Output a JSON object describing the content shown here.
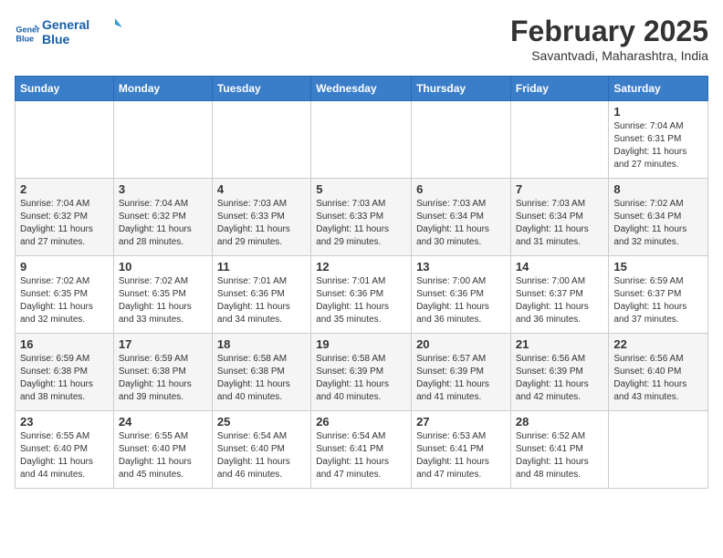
{
  "logo": {
    "general": "General",
    "blue": "Blue"
  },
  "header": {
    "month": "February 2025",
    "location": "Savantvadi, Maharashtra, India"
  },
  "weekdays": [
    "Sunday",
    "Monday",
    "Tuesday",
    "Wednesday",
    "Thursday",
    "Friday",
    "Saturday"
  ],
  "weeks": [
    [
      {
        "day": "",
        "info": ""
      },
      {
        "day": "",
        "info": ""
      },
      {
        "day": "",
        "info": ""
      },
      {
        "day": "",
        "info": ""
      },
      {
        "day": "",
        "info": ""
      },
      {
        "day": "",
        "info": ""
      },
      {
        "day": "1",
        "info": "Sunrise: 7:04 AM\nSunset: 6:31 PM\nDaylight: 11 hours and 27 minutes."
      }
    ],
    [
      {
        "day": "2",
        "info": "Sunrise: 7:04 AM\nSunset: 6:32 PM\nDaylight: 11 hours and 27 minutes."
      },
      {
        "day": "3",
        "info": "Sunrise: 7:04 AM\nSunset: 6:32 PM\nDaylight: 11 hours and 28 minutes."
      },
      {
        "day": "4",
        "info": "Sunrise: 7:03 AM\nSunset: 6:33 PM\nDaylight: 11 hours and 29 minutes."
      },
      {
        "day": "5",
        "info": "Sunrise: 7:03 AM\nSunset: 6:33 PM\nDaylight: 11 hours and 29 minutes."
      },
      {
        "day": "6",
        "info": "Sunrise: 7:03 AM\nSunset: 6:34 PM\nDaylight: 11 hours and 30 minutes."
      },
      {
        "day": "7",
        "info": "Sunrise: 7:03 AM\nSunset: 6:34 PM\nDaylight: 11 hours and 31 minutes."
      },
      {
        "day": "8",
        "info": "Sunrise: 7:02 AM\nSunset: 6:34 PM\nDaylight: 11 hours and 32 minutes."
      }
    ],
    [
      {
        "day": "9",
        "info": "Sunrise: 7:02 AM\nSunset: 6:35 PM\nDaylight: 11 hours and 32 minutes."
      },
      {
        "day": "10",
        "info": "Sunrise: 7:02 AM\nSunset: 6:35 PM\nDaylight: 11 hours and 33 minutes."
      },
      {
        "day": "11",
        "info": "Sunrise: 7:01 AM\nSunset: 6:36 PM\nDaylight: 11 hours and 34 minutes."
      },
      {
        "day": "12",
        "info": "Sunrise: 7:01 AM\nSunset: 6:36 PM\nDaylight: 11 hours and 35 minutes."
      },
      {
        "day": "13",
        "info": "Sunrise: 7:00 AM\nSunset: 6:36 PM\nDaylight: 11 hours and 36 minutes."
      },
      {
        "day": "14",
        "info": "Sunrise: 7:00 AM\nSunset: 6:37 PM\nDaylight: 11 hours and 36 minutes."
      },
      {
        "day": "15",
        "info": "Sunrise: 6:59 AM\nSunset: 6:37 PM\nDaylight: 11 hours and 37 minutes."
      }
    ],
    [
      {
        "day": "16",
        "info": "Sunrise: 6:59 AM\nSunset: 6:38 PM\nDaylight: 11 hours and 38 minutes."
      },
      {
        "day": "17",
        "info": "Sunrise: 6:59 AM\nSunset: 6:38 PM\nDaylight: 11 hours and 39 minutes."
      },
      {
        "day": "18",
        "info": "Sunrise: 6:58 AM\nSunset: 6:38 PM\nDaylight: 11 hours and 40 minutes."
      },
      {
        "day": "19",
        "info": "Sunrise: 6:58 AM\nSunset: 6:39 PM\nDaylight: 11 hours and 40 minutes."
      },
      {
        "day": "20",
        "info": "Sunrise: 6:57 AM\nSunset: 6:39 PM\nDaylight: 11 hours and 41 minutes."
      },
      {
        "day": "21",
        "info": "Sunrise: 6:56 AM\nSunset: 6:39 PM\nDaylight: 11 hours and 42 minutes."
      },
      {
        "day": "22",
        "info": "Sunrise: 6:56 AM\nSunset: 6:40 PM\nDaylight: 11 hours and 43 minutes."
      }
    ],
    [
      {
        "day": "23",
        "info": "Sunrise: 6:55 AM\nSunset: 6:40 PM\nDaylight: 11 hours and 44 minutes."
      },
      {
        "day": "24",
        "info": "Sunrise: 6:55 AM\nSunset: 6:40 PM\nDaylight: 11 hours and 45 minutes."
      },
      {
        "day": "25",
        "info": "Sunrise: 6:54 AM\nSunset: 6:40 PM\nDaylight: 11 hours and 46 minutes."
      },
      {
        "day": "26",
        "info": "Sunrise: 6:54 AM\nSunset: 6:41 PM\nDaylight: 11 hours and 47 minutes."
      },
      {
        "day": "27",
        "info": "Sunrise: 6:53 AM\nSunset: 6:41 PM\nDaylight: 11 hours and 47 minutes."
      },
      {
        "day": "28",
        "info": "Sunrise: 6:52 AM\nSunset: 6:41 PM\nDaylight: 11 hours and 48 minutes."
      },
      {
        "day": "",
        "info": ""
      }
    ]
  ]
}
